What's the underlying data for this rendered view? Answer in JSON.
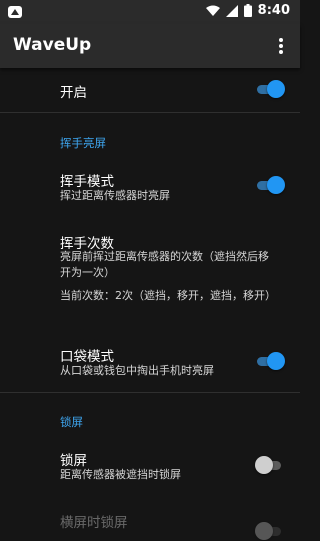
{
  "status": {
    "time": "8:40"
  },
  "app": {
    "title": "WaveUp"
  },
  "settings": {
    "enable": {
      "label": "开启",
      "on": true
    },
    "wave_section": "挥手亮屏",
    "wave_mode": {
      "label": "挥手模式",
      "sub": "挥过距离传感器时亮屏",
      "on": true
    },
    "wave_count": {
      "label": "挥手次数",
      "sub": "亮屏前挥过距离传感器的次数（遮挡然后移开为一次）",
      "current": "当前次数：2次（遮挡，移开，遮挡，移开）"
    },
    "pocket_mode": {
      "label": "口袋模式",
      "sub": "从口袋或钱包中掏出手机时亮屏",
      "on": true
    },
    "lock_section": "锁屏",
    "lock_screen": {
      "label": "锁屏",
      "sub": "距离传感器被遮挡时锁屏",
      "on": false
    },
    "landscape_lock": {
      "label": "横屏时锁屏",
      "sub": "",
      "on": false
    }
  }
}
